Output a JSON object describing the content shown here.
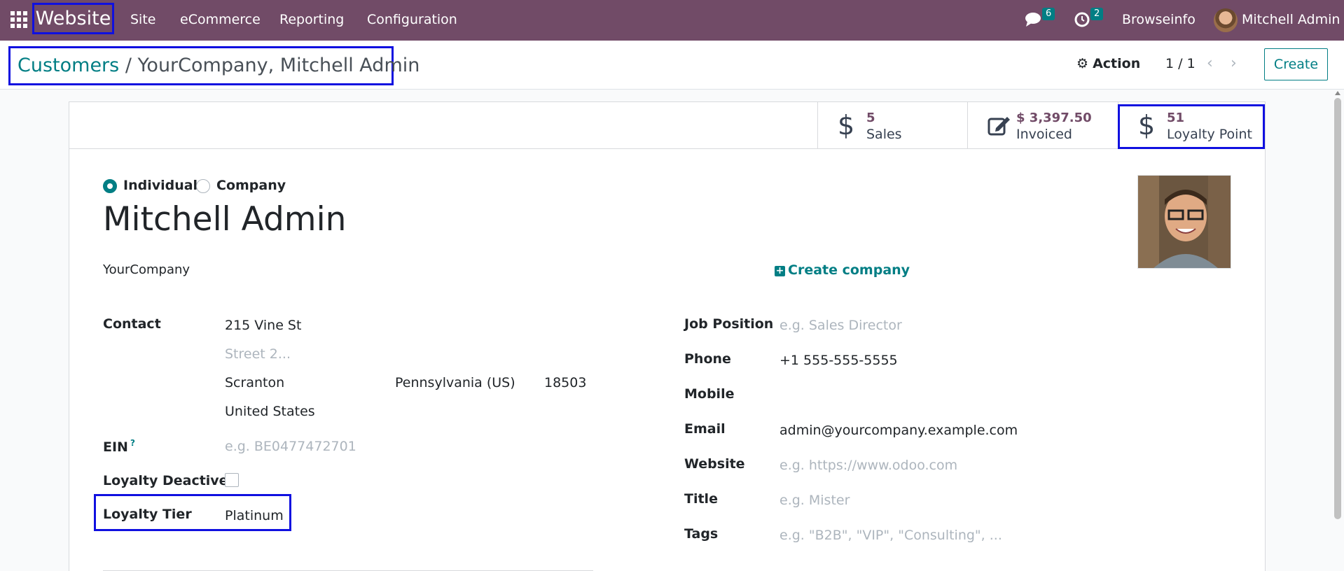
{
  "navbar": {
    "brand": "Website",
    "menu": [
      "Site",
      "eCommerce",
      "Reporting",
      "Configuration"
    ],
    "messages_badge": "6",
    "activities_badge": "2",
    "company": "Browseinfo",
    "user": "Mitchell Admin"
  },
  "breadcrumb": {
    "parent": "Customers",
    "separator": "/",
    "current": "YourCompany, Mitchell Admin"
  },
  "control": {
    "action_label": "Action",
    "pager": "1 / 1",
    "prev_icon": "chevron-left-icon",
    "next_icon": "chevron-right-icon",
    "create_label": "Create"
  },
  "stat_buttons": [
    {
      "value": "5",
      "label": "Sales",
      "icon": "dollar-icon"
    },
    {
      "value": "$ 3,397.50",
      "label": "Invoiced",
      "icon": "edit-icon"
    },
    {
      "value": "51",
      "label": "Loyalty Point",
      "icon": "dollar-icon"
    }
  ],
  "form": {
    "type_individual": "Individual",
    "type_company": "Company",
    "selected_type": "Individual",
    "name": "Mitchell Admin",
    "company_name": "YourCompany",
    "create_company_label": "Create company",
    "address": {
      "label": "Contact",
      "street": "215 Vine St",
      "street2_placeholder": "Street 2...",
      "city": "Scranton",
      "state": "Pennsylvania (US)",
      "zip": "18503",
      "country": "United States"
    },
    "ein": {
      "label": "EIN",
      "help": "?",
      "placeholder": "e.g. BE0477472701"
    },
    "loyalty_deactive": {
      "label": "Loyalty Deactive",
      "checked": false
    },
    "loyalty_tier": {
      "label": "Loyalty Tier",
      "value": "Platinum"
    },
    "job_position": {
      "label": "Job Position",
      "placeholder": "e.g. Sales Director"
    },
    "phone": {
      "label": "Phone",
      "value": "+1 555-555-5555"
    },
    "mobile": {
      "label": "Mobile",
      "value": ""
    },
    "email": {
      "label": "Email",
      "value": "admin@yourcompany.example.com"
    },
    "website": {
      "label": "Website",
      "placeholder": "e.g. https://www.odoo.com"
    },
    "title": {
      "label": "Title",
      "placeholder": "e.g. Mister"
    },
    "tags": {
      "label": "Tags",
      "placeholder": "e.g. \"B2B\", \"VIP\", \"Consulting\", ..."
    }
  },
  "colors": {
    "navbar": "#714b67",
    "accent": "#017e84",
    "highlight_box": "#1010e0"
  }
}
